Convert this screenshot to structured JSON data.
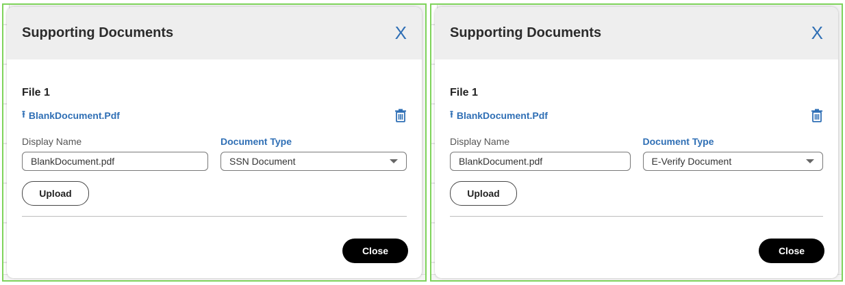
{
  "dialogs": [
    {
      "title": "Supporting Documents",
      "close_x": "X",
      "file_title": "File 1",
      "file_link": "BlankDocument.Pdf",
      "display_name_label": "Display Name",
      "display_name_value": "BlankDocument.pdf",
      "document_type_label": "Document Type",
      "document_type_value": "SSN Document",
      "upload_label": "Upload",
      "close_label": "Close"
    },
    {
      "title": "Supporting Documents",
      "close_x": "X",
      "file_title": "File 1",
      "file_link": "BlankDocument.Pdf",
      "display_name_label": "Display Name",
      "display_name_value": "BlankDocument.pdf",
      "document_type_label": "Document Type",
      "document_type_value": "E-Verify Document",
      "upload_label": "Upload",
      "close_label": "Close"
    }
  ],
  "icons": {
    "upload": "upload-icon",
    "delete": "trash-icon",
    "dropdown": "chevron-down-icon"
  },
  "colors": {
    "accent_blue": "#2f6fb5",
    "primary_button": "#000000",
    "panel_border": "#7ed35a",
    "header_bg": "#eeeeee"
  }
}
